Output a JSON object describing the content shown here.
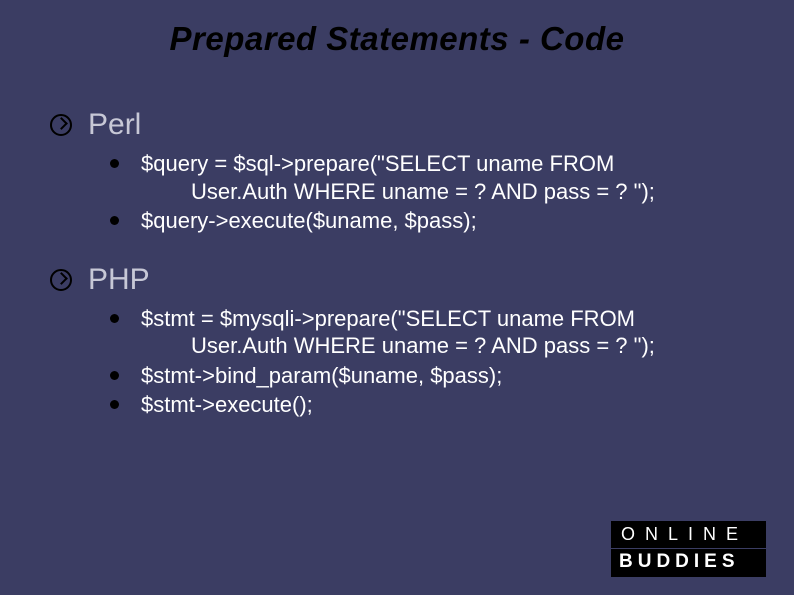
{
  "title": "Prepared Statements - Code",
  "sections": [
    {
      "heading": "Perl",
      "items": [
        {
          "line1": "$query = $sql->prepare(\"SELECT uname FROM",
          "line2": "User.Auth WHERE uname = ? AND pass = ? \");"
        },
        {
          "line1": "$query->execute($uname, $pass);"
        }
      ]
    },
    {
      "heading": "PHP",
      "items": [
        {
          "line1": "$stmt = $mysqli->prepare(\"SELECT uname FROM",
          "line2": "User.Auth WHERE uname = ? AND pass = ? \");"
        },
        {
          "line1": "$stmt->bind_param($uname, $pass);"
        },
        {
          "line1": "$stmt->execute();"
        }
      ]
    }
  ],
  "logo": {
    "top": "ONLINE",
    "bottom": "BUDDIES"
  }
}
